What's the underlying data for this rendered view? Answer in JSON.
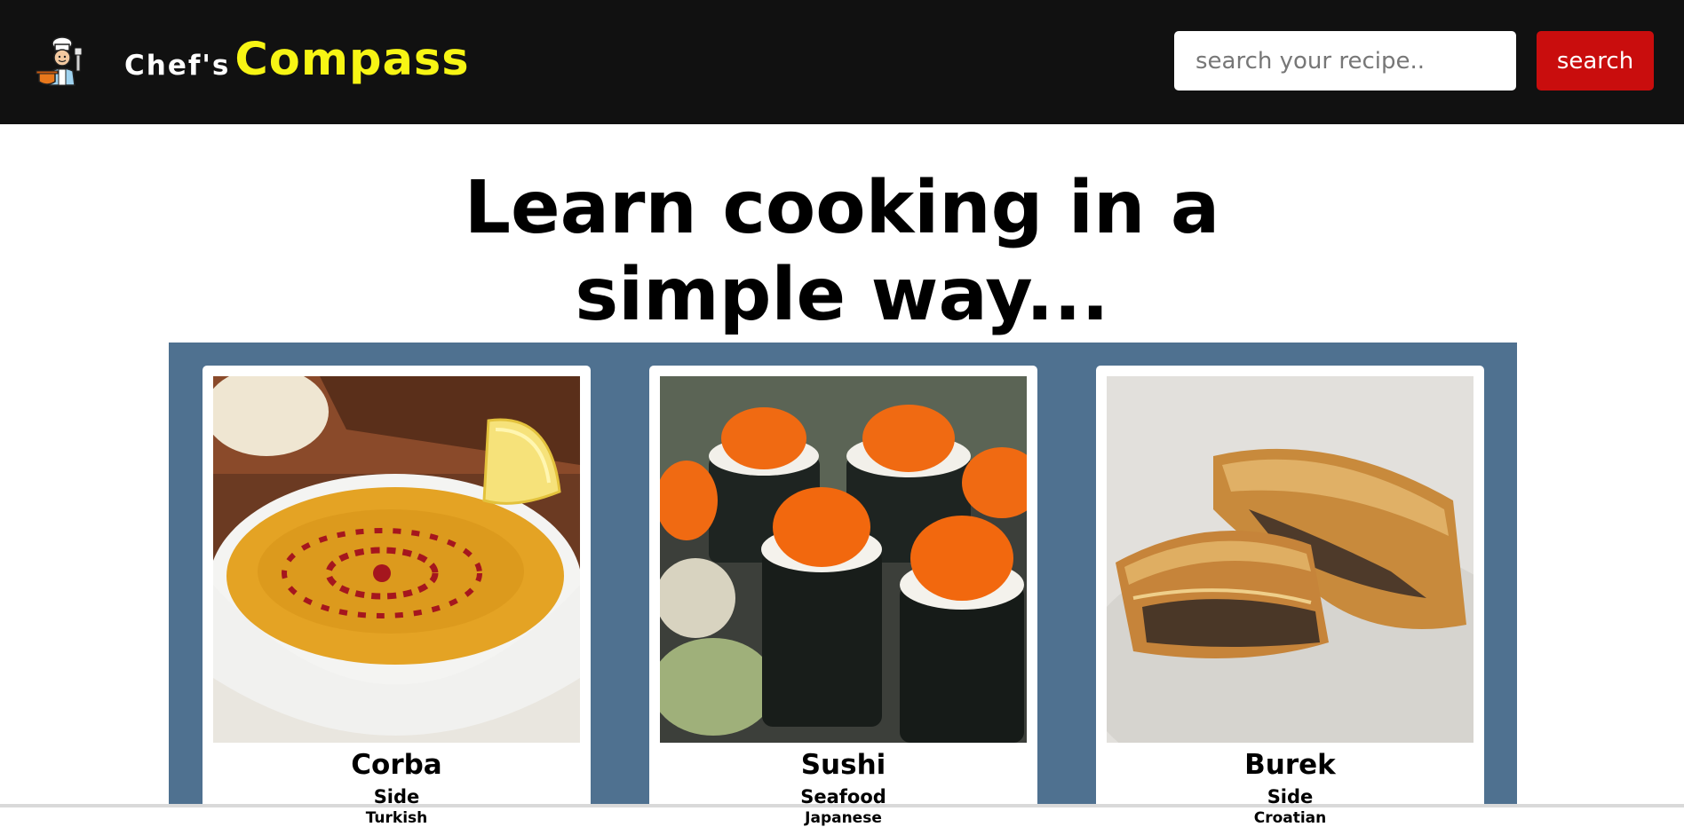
{
  "header": {
    "brand_prefix": "Chef's",
    "brand_name": "Compass",
    "logo_icon": "chef-cooking-icon",
    "search_placeholder": "search your recipe..",
    "search_value": "",
    "search_button_label": "search"
  },
  "main": {
    "headline_line1": "Learn cooking in a",
    "headline_line2": "simple way..."
  },
  "recipes": [
    {
      "title": "Corba",
      "category": "Side",
      "area": "Turkish",
      "image": "lentil-soup-photo"
    },
    {
      "title": "Sushi",
      "category": "Seafood",
      "area": "Japanese",
      "image": "sushi-rolls-photo"
    },
    {
      "title": "Burek",
      "category": "Side",
      "area": "Croatian",
      "image": "burek-pastry-photo"
    }
  ],
  "colors": {
    "header_bg": "#111111",
    "brand_accent": "#f7f514",
    "search_button_bg": "#c90d0d",
    "panel_bg": "#4f7190"
  }
}
